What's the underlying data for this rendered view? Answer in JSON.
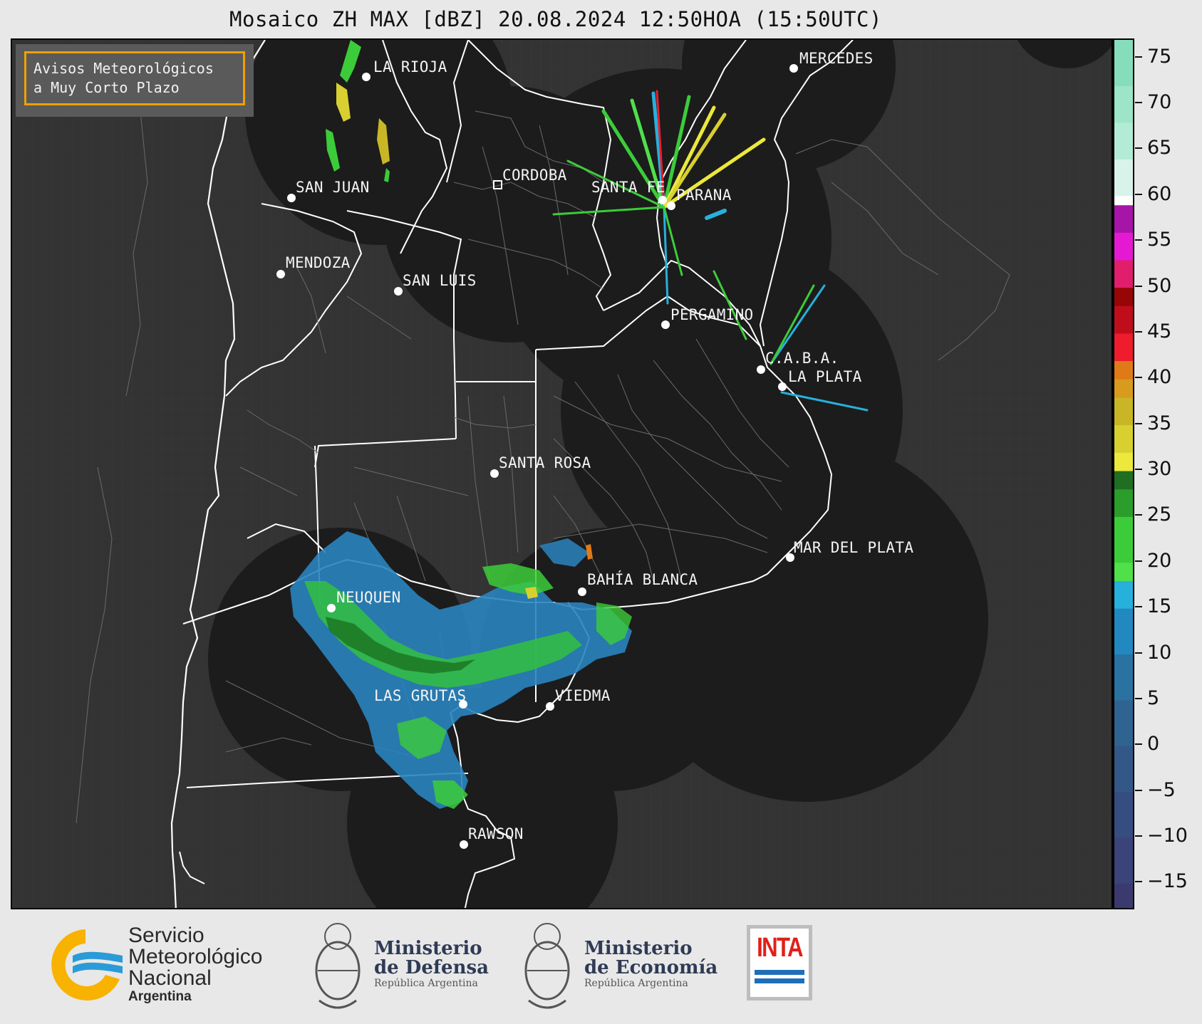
{
  "header": {
    "title": "Mosaico ZH MAX [dBZ] 20.08.2024 12:50HOA (15:50UTC)"
  },
  "notice": {
    "line1": "Avisos Meteorológicos",
    "line2": "a Muy Corto Plazo"
  },
  "cities": [
    {
      "name": "LA RIOJA"
    },
    {
      "name": "MERCEDES"
    },
    {
      "name": "CORDOBA"
    },
    {
      "name": "SAN JUAN"
    },
    {
      "name": "SANTA FE"
    },
    {
      "name": "PARANA"
    },
    {
      "name": "MENDOZA"
    },
    {
      "name": "SAN LUIS"
    },
    {
      "name": "PERGAMINO"
    },
    {
      "name": "C.A.B.A."
    },
    {
      "name": "LA PLATA"
    },
    {
      "name": "SANTA ROSA"
    },
    {
      "name": "MAR DEL PLATA"
    },
    {
      "name": "BAHÍA BLANCA"
    },
    {
      "name": "NEUQUEN"
    },
    {
      "name": "LAS GRUTAS"
    },
    {
      "name": "VIEDMA"
    },
    {
      "name": "RAWSON"
    }
  ],
  "colorbar": {
    "unit": "dBZ",
    "min": -18,
    "max": 77,
    "ticks": [
      "75",
      "70",
      "65",
      "60",
      "55",
      "50",
      "45",
      "40",
      "35",
      "30",
      "25",
      "20",
      "15",
      "10",
      "5",
      "0",
      "−5",
      "−10",
      "−15"
    ],
    "tick_values": [
      75,
      70,
      65,
      60,
      55,
      50,
      45,
      40,
      35,
      30,
      25,
      20,
      15,
      10,
      5,
      0,
      -5,
      -10,
      -15
    ],
    "bands": [
      {
        "from": -18,
        "to": -15,
        "color": "#3b3a6e"
      },
      {
        "from": -15,
        "to": -10,
        "color": "#3a4478"
      },
      {
        "from": -10,
        "to": -5,
        "color": "#364d80"
      },
      {
        "from": -5,
        "to": 0,
        "color": "#335887"
      },
      {
        "from": 0,
        "to": 5,
        "color": "#2f6390"
      },
      {
        "from": 5,
        "to": 10,
        "color": "#2a72a2"
      },
      {
        "from": 10,
        "to": 15,
        "color": "#2288c0"
      },
      {
        "from": 15,
        "to": 18,
        "color": "#27b0dc"
      },
      {
        "from": 18,
        "to": 20,
        "color": "#4fe04a"
      },
      {
        "from": 20,
        "to": 25,
        "color": "#3ccc3a"
      },
      {
        "from": 25,
        "to": 28,
        "color": "#2a9d2a"
      },
      {
        "from": 28,
        "to": 30,
        "color": "#1f6e22"
      },
      {
        "from": 30,
        "to": 32,
        "color": "#ece83c"
      },
      {
        "from": 32,
        "to": 35,
        "color": "#d8cf30"
      },
      {
        "from": 35,
        "to": 38,
        "color": "#c8b626"
      },
      {
        "from": 38,
        "to": 40,
        "color": "#d89b1e"
      },
      {
        "from": 40,
        "to": 42,
        "color": "#e07a18"
      },
      {
        "from": 42,
        "to": 45,
        "color": "#ee1c2c"
      },
      {
        "from": 45,
        "to": 48,
        "color": "#c00d1c"
      },
      {
        "from": 48,
        "to": 50,
        "color": "#960606"
      },
      {
        "from": 50,
        "to": 53,
        "color": "#e01e6c"
      },
      {
        "from": 53,
        "to": 56,
        "color": "#e41ad2"
      },
      {
        "from": 56,
        "to": 59,
        "color": "#a614a8"
      },
      {
        "from": 59,
        "to": 60,
        "color": "#ffffff"
      },
      {
        "from": 60,
        "to": 64,
        "color": "#d9f3ea"
      },
      {
        "from": 64,
        "to": 68,
        "color": "#b2ebd6"
      },
      {
        "from": 68,
        "to": 72,
        "color": "#9ce5c8"
      },
      {
        "from": 72,
        "to": 77,
        "color": "#85ddbc"
      }
    ]
  },
  "logos": {
    "smn": {
      "line1": "Servicio",
      "line2": "Meteorológico",
      "line3": "Nacional",
      "line4": "Argentina"
    },
    "defensa": {
      "line1": "Ministerio",
      "line2": "de Defensa",
      "line3": "República Argentina"
    },
    "economia": {
      "line1": "Ministerio",
      "line2": "de Economía",
      "line3": "República Argentina"
    },
    "inta": {
      "text": "INTA"
    }
  }
}
